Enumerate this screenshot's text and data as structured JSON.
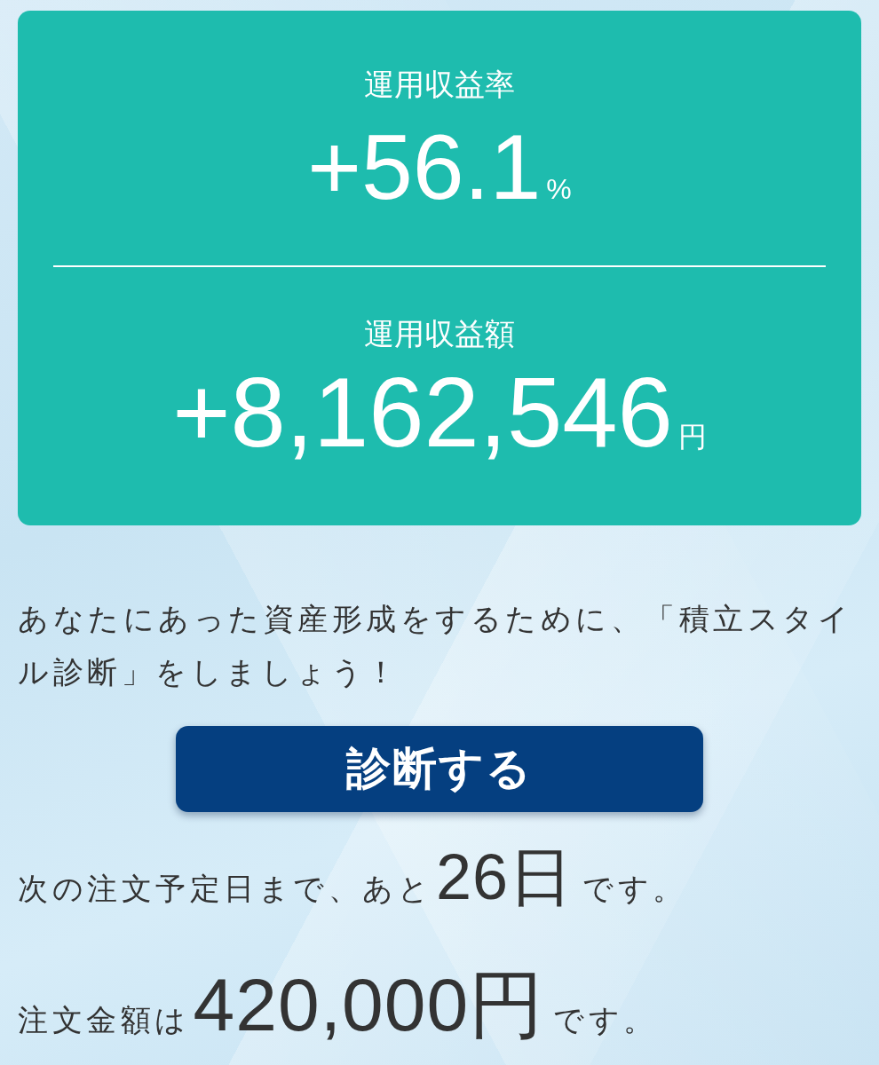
{
  "summary_card": {
    "metrics": [
      {
        "label": "運用収益率",
        "value": "+56.1",
        "unit": "%"
      },
      {
        "label": "運用収益額",
        "value": "+8,162,546",
        "unit": "円"
      }
    ]
  },
  "message": "あなたにあった資産形成をするために、「積立スタイル診断」をしましょう！",
  "diagnose_button": {
    "label": "診断する"
  },
  "next_order": {
    "prefix": "次の注文予定日まで、あと",
    "value": "26日",
    "suffix": "です。"
  },
  "order_amount": {
    "prefix": "注文金額は",
    "value": "420,000円",
    "suffix": "です。"
  }
}
